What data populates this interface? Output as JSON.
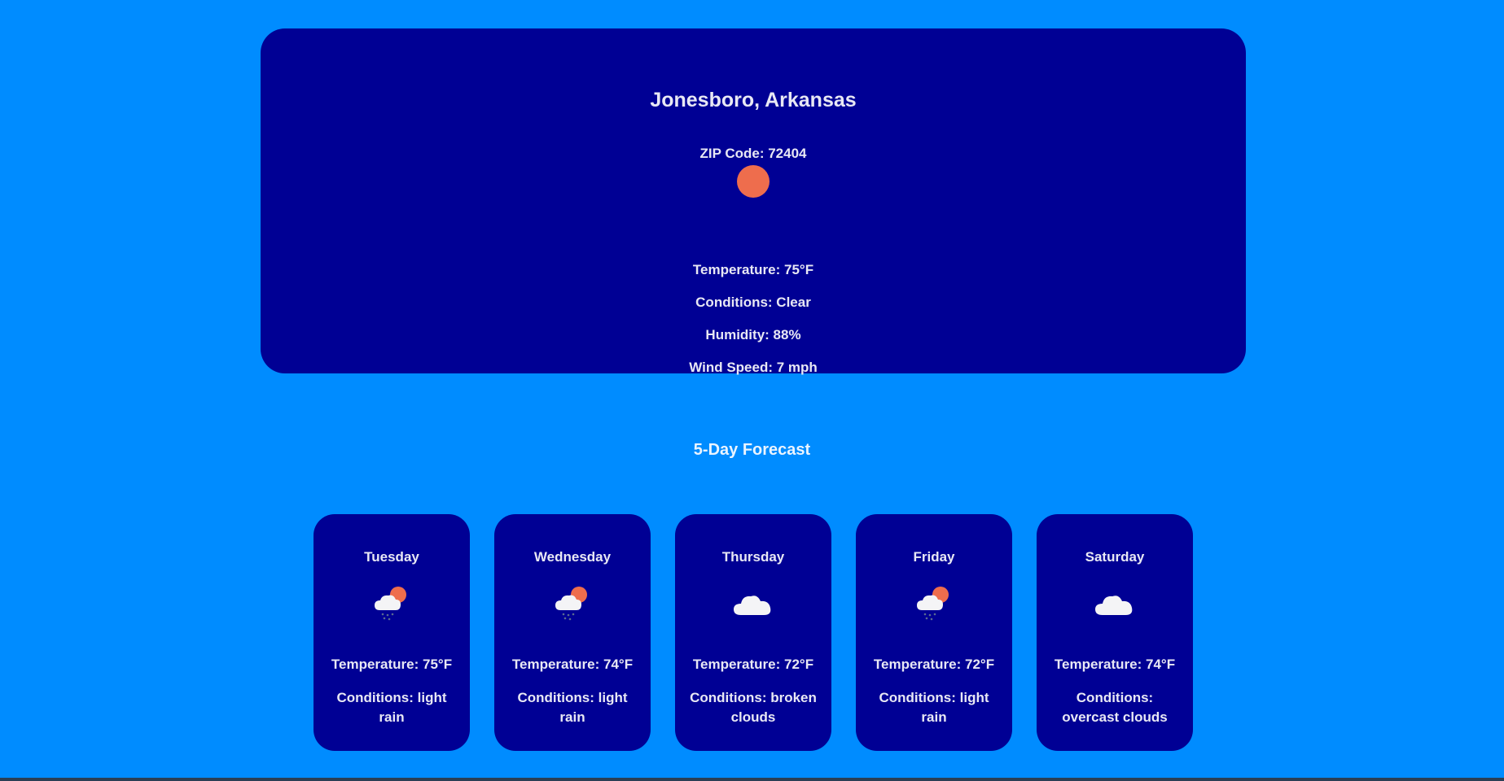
{
  "current": {
    "city": "Jonesboro, Arkansas",
    "zip": "ZIP Code: 72404",
    "icon": "sun-icon",
    "temperature": "Temperature: 75°F",
    "conditions": "Conditions: Clear",
    "humidity": "Humidity: 88%",
    "wind": "Wind Speed: 7 mph"
  },
  "forecast": {
    "title": "5-Day Forecast",
    "days": [
      {
        "day": "Tuesday",
        "icon": "rain-sun-cloud-icon",
        "temperature": "Temperature: 75°F",
        "conditions": "Conditions: light rain"
      },
      {
        "day": "Wednesday",
        "icon": "rain-sun-cloud-icon",
        "temperature": "Temperature: 74°F",
        "conditions": "Conditions: light rain"
      },
      {
        "day": "Thursday",
        "icon": "cloud-icon",
        "temperature": "Temperature: 72°F",
        "conditions": "Conditions: broken clouds"
      },
      {
        "day": "Friday",
        "icon": "rain-sun-cloud-icon",
        "temperature": "Temperature: 72°F",
        "conditions": "Conditions: light rain"
      },
      {
        "day": "Saturday",
        "icon": "cloud-icon",
        "temperature": "Temperature: 74°F",
        "conditions": "Conditions: overcast clouds"
      }
    ]
  },
  "colors": {
    "background": "#008cff",
    "card": "#000094",
    "sun": "#ee6d4d",
    "text": "#e8e8f4"
  }
}
